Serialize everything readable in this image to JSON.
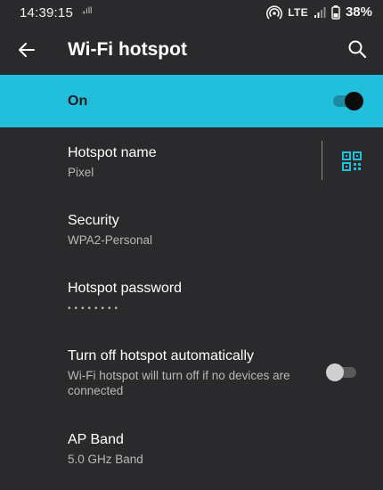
{
  "status_bar": {
    "time": "14:39:15",
    "signal_indicator": "₄ıll",
    "network": "LTE",
    "battery_percent": "38%",
    "icons": [
      "hotspot-icon",
      "signal-icon",
      "battery-icon"
    ]
  },
  "app_bar": {
    "title": "Wi-Fi hotspot",
    "back_icon": "back-arrow-icon",
    "search_icon": "search-icon"
  },
  "master_switch": {
    "label": "On",
    "checked": true,
    "accent_color": "#22bfdc"
  },
  "settings": [
    {
      "title": "Hotspot name",
      "subtitle": "Pixel",
      "action_icon": "qr-code-icon"
    },
    {
      "title": "Security",
      "subtitle": "WPA2-Personal"
    },
    {
      "title": "Hotspot password",
      "subtitle": "••••••••"
    },
    {
      "title": "Turn off hotspot automatically",
      "subtitle": "Wi-Fi hotspot will turn off if no devices are connected",
      "checked": false
    },
    {
      "title": "AP Band",
      "subtitle": "5.0 GHz Band"
    }
  ]
}
